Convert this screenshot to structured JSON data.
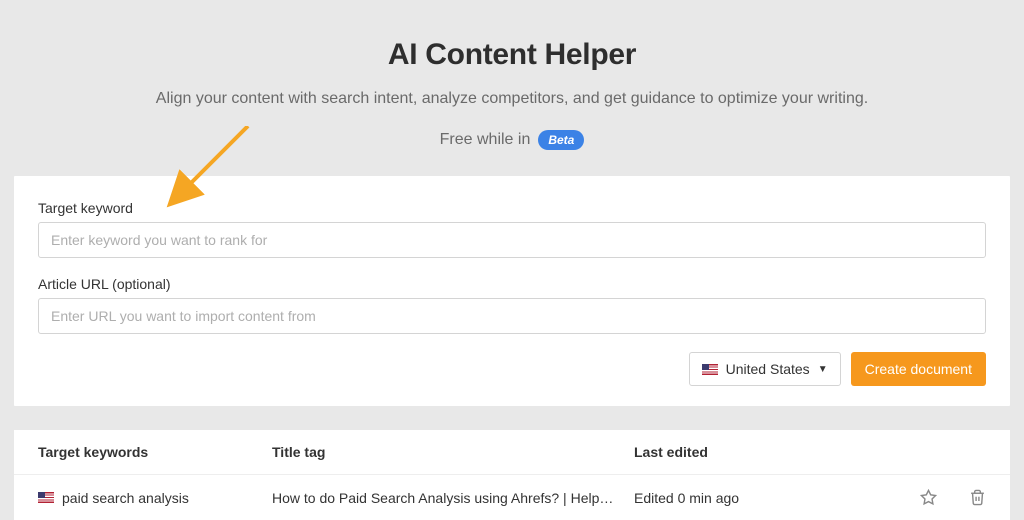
{
  "header": {
    "title": "AI Content Helper",
    "subtitle": "Align your content with search intent, analyze competitors, and get guidance to optimize your writing.",
    "free_prefix": "Free while in",
    "beta_label": "Beta"
  },
  "form": {
    "keyword_label": "Target keyword",
    "keyword_placeholder": "Enter keyword you want to rank for",
    "url_label": "Article URL (optional)",
    "url_placeholder": "Enter URL you want to import content from"
  },
  "actions": {
    "country_label": "United States",
    "create_label": "Create document"
  },
  "table": {
    "headers": {
      "keywords": "Target keywords",
      "title": "Title tag",
      "edited": "Last edited"
    },
    "rows": [
      {
        "keyword": "paid search analysis",
        "title": "How to do Paid Search Analysis using Ahrefs? | Help Cent…",
        "edited": "Edited 0 min ago"
      }
    ]
  }
}
